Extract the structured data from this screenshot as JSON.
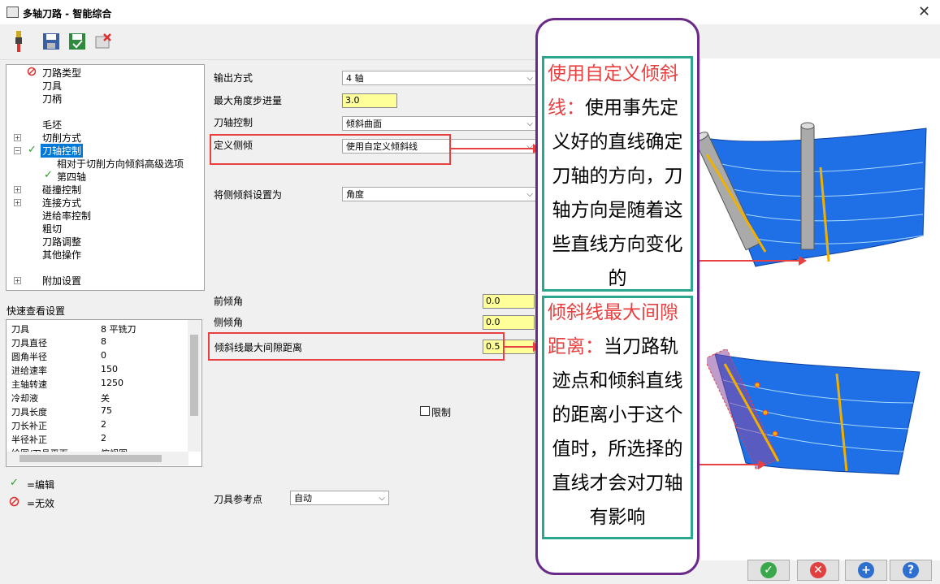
{
  "window": {
    "title": "多轴刀路 - 智能综合",
    "close_glyph": "✕"
  },
  "toolbar": {
    "icons": [
      "tool-icon",
      "save-icon",
      "save-green-icon",
      "delete-icon"
    ]
  },
  "tree": {
    "items": [
      {
        "label": "刀路类型"
      },
      {
        "label": "刀具"
      },
      {
        "label": "刀柄"
      },
      {
        "label": "毛坯"
      },
      {
        "label": "切削方式"
      },
      {
        "label": "刀轴控制"
      },
      {
        "label": "相对于切削方向倾斜高级选项"
      },
      {
        "label": "第四轴"
      },
      {
        "label": "碰撞控制"
      },
      {
        "label": "连接方式"
      },
      {
        "label": "进给率控制"
      },
      {
        "label": "粗切"
      },
      {
        "label": "刀路调整"
      },
      {
        "label": "其他操作"
      },
      {
        "label": "附加设置"
      }
    ]
  },
  "quick": {
    "title": "快速查看设置",
    "rows": [
      {
        "k": "刀具",
        "v": "8 平铣刀"
      },
      {
        "k": "刀具直径",
        "v": "8"
      },
      {
        "k": "圆角半径",
        "v": "0"
      },
      {
        "k": "进给速率",
        "v": "150"
      },
      {
        "k": "主轴转速",
        "v": "1250"
      },
      {
        "k": "冷却液",
        "v": "关"
      },
      {
        "k": "刀具长度",
        "v": "75"
      },
      {
        "k": "刀长补正",
        "v": "2"
      },
      {
        "k": "半径补正",
        "v": "2"
      },
      {
        "k": "绘图/刀具平面",
        "v": "俯视图"
      }
    ]
  },
  "legend": {
    "edit": "=编辑",
    "invalid": "=无效"
  },
  "form": {
    "output_label": "输出方式",
    "output_value": "4 轴",
    "max_step_label": "最大角度步进量",
    "max_step_value": "3.0",
    "axis_ctrl_label": "刀轴控制",
    "axis_ctrl_value": "倾斜曲面",
    "side_tilt_label": "定义侧倾",
    "side_tilt_value": "使用自定义倾斜线",
    "set_tilt_label": "将侧倾斜设置为",
    "set_tilt_value": "角度",
    "lead_label": "前倾角",
    "lead_value": "0.0",
    "side_label": "侧倾角",
    "side_value": "0.0",
    "gap_label": "倾斜线最大间隙距离",
    "gap_value": "0.5",
    "limit_label": "限制",
    "ref_label": "刀具参考点",
    "ref_value": "自动"
  },
  "callouts": {
    "c1_red": "使用自定义倾斜线：",
    "c1_lines": [
      "使用事先定",
      "义好的直线确定",
      "刀轴的方向，刀",
      "轴方向是随着这",
      "些直线方向变化",
      "的"
    ],
    "c1_red_lines": [
      "使用自定义倾斜",
      "线："
    ],
    "c2_red_lines": [
      "倾斜线最大间隙",
      "距离："
    ],
    "c2_lines": [
      "当刀路轨",
      "迹点和倾斜直线",
      "的距离小于这个",
      "值时，所选择的",
      "直线才会对刀轴",
      "有影响"
    ]
  },
  "buttons": {
    "ok": "✓",
    "cancel": "✕",
    "add": "+",
    "help": "?"
  },
  "colors": {
    "accent": "#0078d7",
    "red": "#e84040",
    "teal": "#2aa58e",
    "purple": "#6a2a8a",
    "surface": "#1f6fe6"
  }
}
